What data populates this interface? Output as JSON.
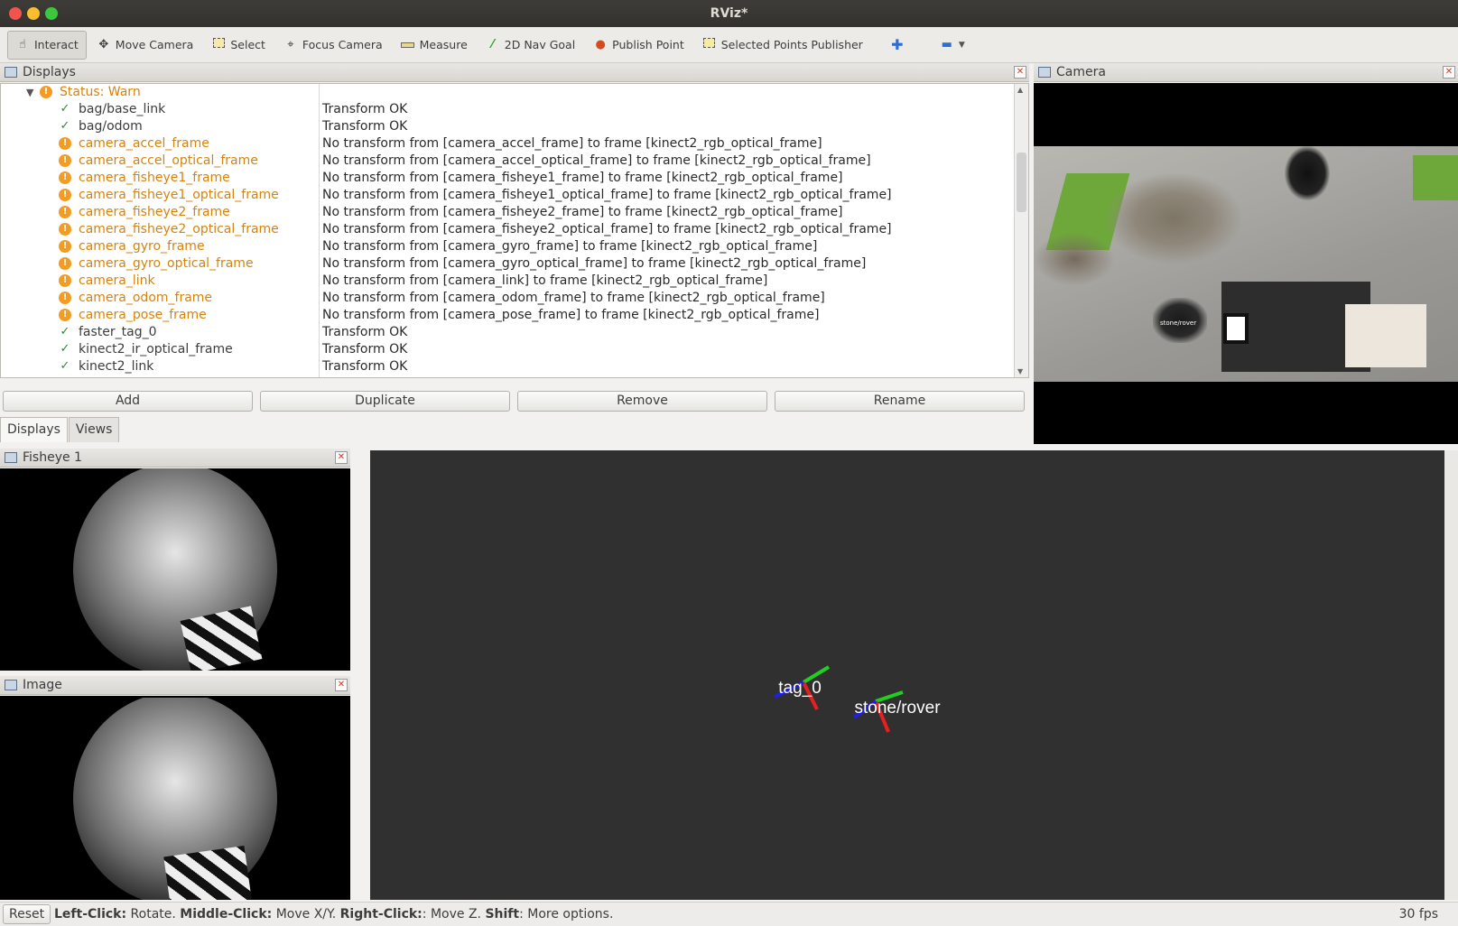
{
  "window": {
    "title": "RViz*"
  },
  "toolbar": {
    "tools": [
      {
        "label": "Interact",
        "icon": "hand-icon"
      },
      {
        "label": "Move Camera",
        "icon": "move-camera-icon"
      },
      {
        "label": "Select",
        "icon": "select-icon"
      },
      {
        "label": "Focus Camera",
        "icon": "focus-camera-icon"
      },
      {
        "label": "Measure",
        "icon": "measure-icon"
      },
      {
        "label": "2D Nav Goal",
        "icon": "nav-goal-icon"
      },
      {
        "label": "Publish Point",
        "icon": "publish-point-icon"
      },
      {
        "label": "Selected Points Publisher",
        "icon": "selected-points-icon"
      }
    ]
  },
  "displays_panel": {
    "title": "Displays",
    "status_label": "Status: Warn",
    "rows": [
      {
        "name": "bag/base_link",
        "status": "ok",
        "message": "Transform OK"
      },
      {
        "name": "bag/odom",
        "status": "ok",
        "message": "Transform OK"
      },
      {
        "name": "camera_accel_frame",
        "status": "warn",
        "message": "No transform from [camera_accel_frame] to frame [kinect2_rgb_optical_frame]"
      },
      {
        "name": "camera_accel_optical_frame",
        "status": "warn",
        "message": "No transform from [camera_accel_optical_frame] to frame [kinect2_rgb_optical_frame]"
      },
      {
        "name": "camera_fisheye1_frame",
        "status": "warn",
        "message": "No transform from [camera_fisheye1_frame] to frame [kinect2_rgb_optical_frame]"
      },
      {
        "name": "camera_fisheye1_optical_frame",
        "status": "warn",
        "message": "No transform from [camera_fisheye1_optical_frame] to frame [kinect2_rgb_optical_frame]"
      },
      {
        "name": "camera_fisheye2_frame",
        "status": "warn",
        "message": "No transform from [camera_fisheye2_frame] to frame [kinect2_rgb_optical_frame]"
      },
      {
        "name": "camera_fisheye2_optical_frame",
        "status": "warn",
        "message": "No transform from [camera_fisheye2_optical_frame] to frame [kinect2_rgb_optical_frame]"
      },
      {
        "name": "camera_gyro_frame",
        "status": "warn",
        "message": "No transform from [camera_gyro_frame] to frame [kinect2_rgb_optical_frame]"
      },
      {
        "name": "camera_gyro_optical_frame",
        "status": "warn",
        "message": "No transform from [camera_gyro_optical_frame] to frame [kinect2_rgb_optical_frame]"
      },
      {
        "name": "camera_link",
        "status": "warn",
        "message": "No transform from [camera_link] to frame [kinect2_rgb_optical_frame]"
      },
      {
        "name": "camera_odom_frame",
        "status": "warn",
        "message": "No transform from [camera_odom_frame] to frame [kinect2_rgb_optical_frame]"
      },
      {
        "name": "camera_pose_frame",
        "status": "warn",
        "message": "No transform from [camera_pose_frame] to frame [kinect2_rgb_optical_frame]"
      },
      {
        "name": "faster_tag_0",
        "status": "ok",
        "message": "Transform OK"
      },
      {
        "name": "kinect2_ir_optical_frame",
        "status": "ok",
        "message": "Transform OK"
      },
      {
        "name": "kinect2_link",
        "status": "ok",
        "message": "Transform OK"
      }
    ],
    "buttons": {
      "add": "Add",
      "duplicate": "Duplicate",
      "remove": "Remove",
      "rename": "Rename"
    },
    "tabs": {
      "displays": "Displays",
      "views": "Views"
    }
  },
  "camera_panel": {
    "title": "Camera",
    "overlay_label": "stone/rover"
  },
  "fisheye_panel": {
    "title": "Fisheye 1"
  },
  "image_panel": {
    "title": "Image"
  },
  "view3d": {
    "frames": [
      {
        "label": "tag_0"
      },
      {
        "label": "stone/rover"
      }
    ]
  },
  "statusbar": {
    "reset": "Reset",
    "hint_parts": [
      {
        "b": "Left-Click:",
        "t": " Rotate. "
      },
      {
        "b": "Middle-Click:",
        "t": " Move X/Y. "
      },
      {
        "b": "Right-Click:",
        "t": ": Move Z. "
      },
      {
        "b": "Shift",
        "t": ": More options."
      }
    ],
    "fps": "30 fps"
  },
  "colors": {
    "ok": "#2f8a2f",
    "warn": "#f39c23",
    "warn_text": "#d6830c",
    "axis_x": "#e62020",
    "axis_y": "#20d020",
    "axis_z": "#1f1fe6"
  }
}
